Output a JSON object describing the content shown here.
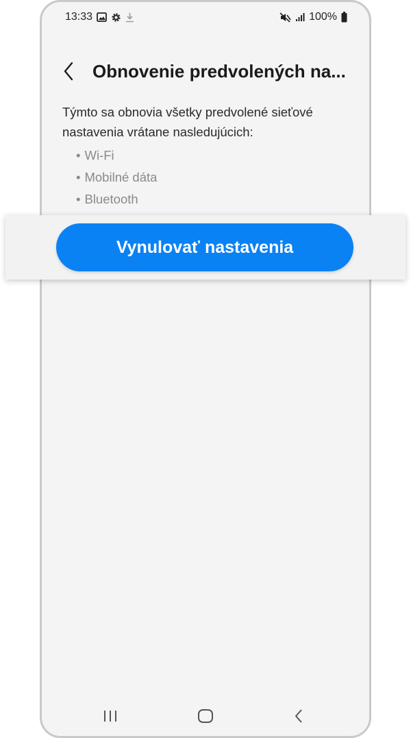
{
  "status_bar": {
    "time": "13:33",
    "left_icons": [
      "image-icon",
      "settings-gear-icon",
      "download-icon"
    ],
    "right_icons": [
      "mute-icon",
      "signal-icon"
    ],
    "battery": "100%"
  },
  "header": {
    "title": "Obnovenie predvolených na..."
  },
  "content": {
    "description": "Týmto sa obnovia všetky predvolené sieťové nastavenia vrátane nasledujúcich:",
    "bullet": "•",
    "items": [
      "Wi-Fi",
      "Mobilné dáta",
      "Bluetooth"
    ]
  },
  "action": {
    "reset_label": "Vynulovať nastavenia",
    "color": "#0b82f4"
  },
  "nav_bar": {
    "icons": [
      "recent-apps-icon",
      "home-icon",
      "back-icon"
    ]
  }
}
